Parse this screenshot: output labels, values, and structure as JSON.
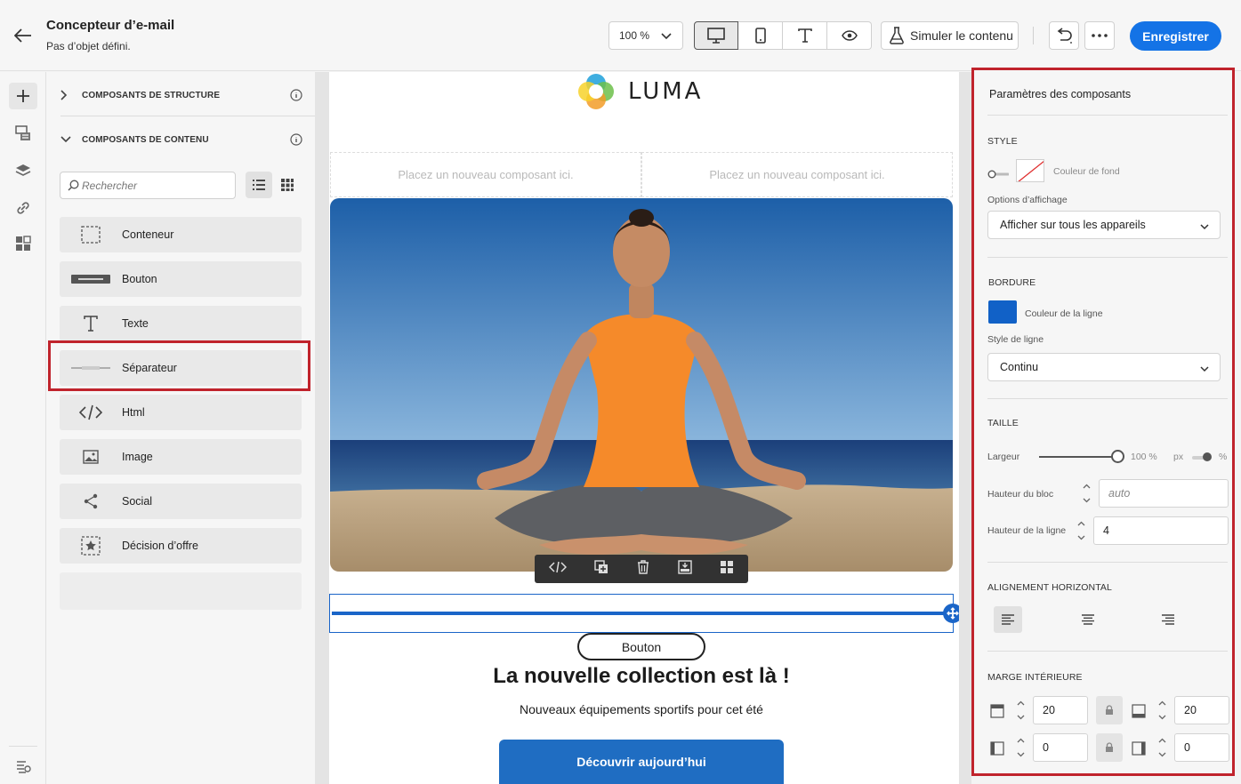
{
  "header": {
    "title": "Concepteur d’e-mail",
    "subtitle": "Pas d’objet défini.",
    "zoom": "100 %",
    "simulate_label": "Simuler le contenu",
    "save_label": "Enregistrer"
  },
  "components_panel": {
    "structure_section": "COMPOSANTS DE STRUCTURE",
    "content_section": "COMPOSANTS DE CONTENU",
    "search_placeholder": "Rechercher",
    "items": [
      {
        "label": "Conteneur",
        "icon": "container-icon"
      },
      {
        "label": "Bouton",
        "icon": "button-icon"
      },
      {
        "label": "Texte",
        "icon": "text-icon"
      },
      {
        "label": "Séparateur",
        "icon": "divider-icon"
      },
      {
        "label": "Html",
        "icon": "code-icon"
      },
      {
        "label": "Image",
        "icon": "image-icon"
      },
      {
        "label": "Social",
        "icon": "share-icon"
      },
      {
        "label": "Décision d’offre",
        "icon": "offer-decision-icon"
      }
    ]
  },
  "canvas": {
    "logo_text": "LUMA",
    "drop_zone_left": "Placez un nouveau composant ici.",
    "drop_zone_right": "Placez un nouveau composant ici.",
    "button_label": "Bouton",
    "headline": "La nouvelle collection est là !",
    "subline": "Nouveaux équipements sportifs pour cet été",
    "cta_label": "Découvrir aujourd’hui"
  },
  "settings": {
    "title": "Paramètres des composants",
    "style_head": "STYLE",
    "bg_color_label": "Couleur de fond",
    "display_options_label": "Options d’affichage",
    "display_options_value": "Afficher sur tous les appareils",
    "border_head": "BORDURE",
    "line_color_label": "Couleur de la ligne",
    "line_color": "#1161c7",
    "line_style_label": "Style de ligne",
    "line_style_value": "Continu",
    "size_head": "TAILLE",
    "width_label": "Largeur",
    "width_value": "100 %",
    "width_fraction": 1.0,
    "unit_px": "px",
    "unit_pct": "%",
    "block_height_label": "Hauteur du bloc",
    "block_height_placeholder": "auto",
    "line_height_label": "Hauteur de la ligne",
    "line_height_value": "4",
    "align_head": "ALIGNEMENT HORIZONTAL",
    "padding_head": "MARGE INTÉRIEURE",
    "padding_top": "20",
    "padding_bottom": "20",
    "padding_left": "0",
    "padding_right": "0"
  },
  "colors": {
    "accent": "#1473e6",
    "highlight": "#c0232c",
    "selection": "#1a65c8"
  }
}
